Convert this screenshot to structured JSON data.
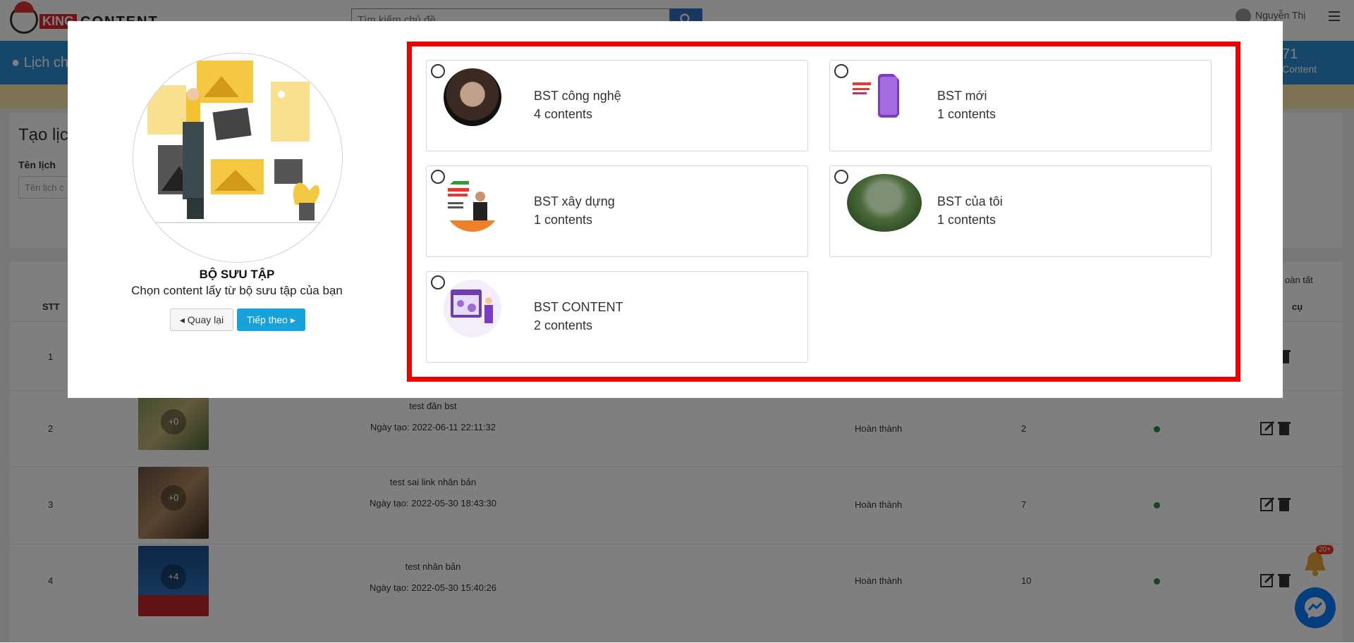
{
  "background": {
    "search_placeholder": "Tìm kiếm chủ đề",
    "user_name": "Nguyễn Thị",
    "bluebar_title": "Lịch ch",
    "bluebar_count": "71",
    "bluebar_count_label": "Content",
    "create_title": "Tạo lịc",
    "create_label": "Tên lịch",
    "create_placeholder": "Tên lịch c",
    "complete_label": "oàn tất",
    "col_stt": "STT",
    "col_tools": "cụ",
    "rows": [
      {
        "stt": "1",
        "name": "",
        "date": "",
        "status": "",
        "count": "",
        "overlay": ""
      },
      {
        "stt": "2",
        "name": "test đăn bst",
        "date": "Ngày tạo: 2022-06-11 22:11:32",
        "status": "Hoàn thành",
        "count": "2",
        "overlay": "+0"
      },
      {
        "stt": "3",
        "name": "test sai link nhân bản",
        "date": "Ngày tạo: 2022-05-30 18:43:30",
        "status": "Hoàn thành",
        "count": "7",
        "overlay": "+0"
      },
      {
        "stt": "4",
        "name": "test nhân bản",
        "date": "Ngày tạo: 2022-05-30 15:40:26",
        "status": "Hoàn thành",
        "count": "10",
        "overlay": "+4"
      }
    ],
    "bell_badge": "20+"
  },
  "modal": {
    "title": "BỘ SƯU TẬP",
    "subtitle": "Chọn content lấy từ bộ sưu tập của bạn",
    "back_label": "Quay lại",
    "next_label": "Tiếp theo",
    "collections": [
      {
        "name": "BST công nghệ",
        "count": "4 contents"
      },
      {
        "name": "BST mới",
        "count": "1 contents"
      },
      {
        "name": "BST xây dựng",
        "count": "1 contents"
      },
      {
        "name": "BST của tôi",
        "count": "1 contents"
      },
      {
        "name": "BST CONTENT",
        "count": "2 contents"
      }
    ]
  },
  "colors": {
    "highlight": "#ee0000",
    "primary": "#17a2d9",
    "bluebar": "#2e8fd0"
  }
}
